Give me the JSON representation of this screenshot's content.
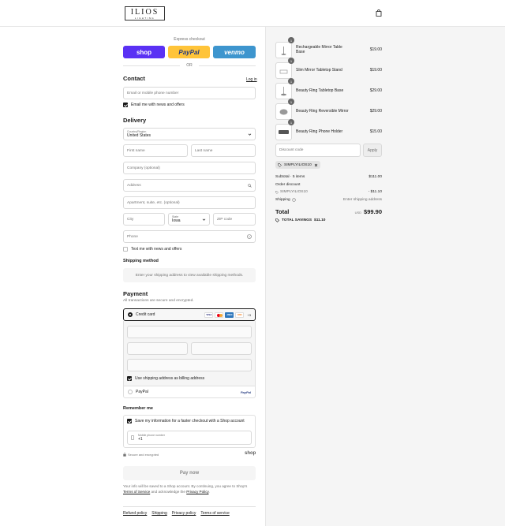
{
  "header": {
    "logo_main": "ILIOS",
    "logo_sub": "LIGHTING"
  },
  "express": {
    "title": "Express checkout",
    "shop_label": "shop",
    "paypal_label": "PayPal",
    "venmo_label": "venmo",
    "or_label": "OR"
  },
  "contact": {
    "title": "Contact",
    "login_label": "Log in",
    "email_placeholder": "Email or mobile phone number",
    "news_label": "Email me with news and offers"
  },
  "delivery": {
    "title": "Delivery",
    "country_label": "Country/Region",
    "country_value": "United States",
    "first_name": "First name",
    "last_name": "Last name",
    "company": "Company (optional)",
    "address": "Address",
    "apartment": "Apartment, suite, etc. (optional)",
    "city": "City",
    "state_label": "State",
    "state_value": "Iowa",
    "zip": "ZIP code",
    "phone": "Phone",
    "text_label": "Text me with news and offers"
  },
  "shipping": {
    "title": "Shipping method",
    "message": "Enter your shipping address to view available shipping methods."
  },
  "payment": {
    "title": "Payment",
    "subtitle": "All transactions are secure and encrypted.",
    "credit_card_label": "Credit card",
    "card_logos": [
      "VISA",
      "MC",
      "AMEX",
      "DISC"
    ],
    "more_cards": "+3",
    "billing_label": "Use shipping address as billing address",
    "paypal_label": "PayPal",
    "paypal_logo": "PayPal"
  },
  "remember": {
    "title": "Remember me",
    "save_label": "Save my information for a faster checkout with a Shop account",
    "mobile_label": "Mobile phone number",
    "mobile_value": "+1",
    "secure_label": "Secure and encrypted",
    "shop_logo": "shop"
  },
  "pay_now": {
    "label": "Pay now",
    "terms_text": "Your info will be saved to a Shop account. By continuing, you agree to Shop's",
    "terms_link": "Terms of Service",
    "terms_mid": "and acknowledge the",
    "privacy_link": "Privacy Policy",
    "terms_end": "."
  },
  "footer": {
    "links": [
      "Refund policy",
      "Shipping",
      "Privacy policy",
      "Terms of service"
    ]
  },
  "order": {
    "items": [
      {
        "qty": "1",
        "name": "Rechargeable Mirror Table Base",
        "price": "$19.00"
      },
      {
        "qty": "1",
        "name": "Slim Mirror Tabletop Stand",
        "price": "$19.00"
      },
      {
        "qty": "1",
        "name": "Beauty Ring Tabletop Base",
        "price": "$29.00"
      },
      {
        "qty": "1",
        "name": "Beauty Ring Reversible Mirror",
        "price": "$29.00"
      },
      {
        "qty": "1",
        "name": "Beauty Ring Phone Holder",
        "price": "$15.00"
      }
    ],
    "discount_placeholder": "Discount code",
    "apply_label": "Apply",
    "tag_code": "SIMPLYILIOS10",
    "subtotal_label": "Subtotal · 5 items",
    "subtotal_value": "$111.00",
    "order_discount_label": "Order discount",
    "order_discount_code": "SIMPLYILIOS10",
    "order_discount_value": "- $11.10",
    "shipping_label": "Shipping",
    "shipping_value": "Enter shipping address",
    "total_label": "Total",
    "currency": "USD",
    "total_value": "$99.90",
    "savings_label": "TOTAL SAVINGS",
    "savings_value": "$11.10"
  }
}
